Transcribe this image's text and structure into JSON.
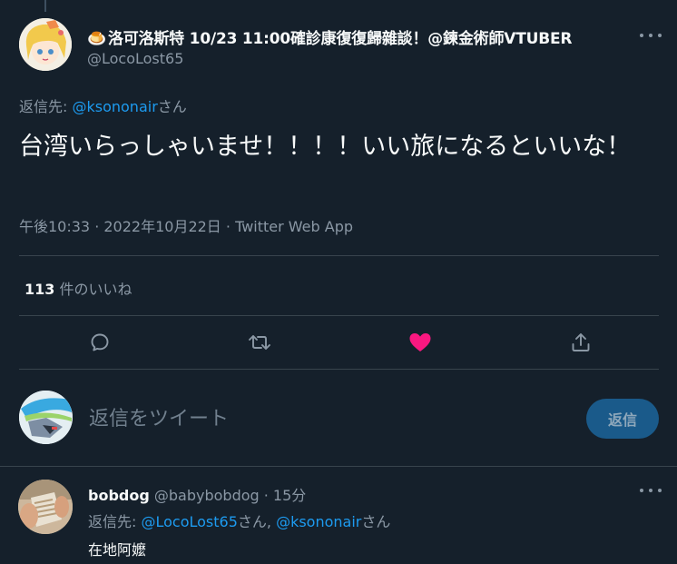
{
  "tweet": {
    "author": {
      "emoji": "🍮",
      "display_name": "洛可洛斯特 10/23 11:00確診康復復歸雜談！@鍊金術師VTUBER",
      "handle": "@LocoLost65",
      "avatar": "anime-avatar-icon"
    },
    "reply_to_label": "返信先: ",
    "reply_to_mention": "@ksononair",
    "reply_to_suffix": "さん",
    "text": "台湾いらっしゃいませ！！！！いい旅になるといいな！",
    "meta": "午後10:33 · 2022年10月22日 · Twitter Web App",
    "likes_count": "113",
    "likes_label": " 件のいいね",
    "actions": [
      "reply-icon",
      "retweet-icon",
      "liked-heart-icon",
      "share-icon"
    ]
  },
  "compose": {
    "placeholder": "返信をツイート",
    "button_label": "返信",
    "avatar": "mecha-avatar-icon"
  },
  "reply": {
    "name": "bobdog",
    "handle": " @babybobdog",
    "time": " · 15分",
    "reply_to_label": "返信先: ",
    "mention_1": "@LocoLost65",
    "between": "さん, ",
    "mention_2": "@ksononair",
    "suffix": "さん",
    "text": "在地阿嬤",
    "avatar": "photo-avatar-icon"
  },
  "colors": {
    "background": "#15202b",
    "accent": "#1d9bf0",
    "like": "#f91880",
    "muted": "#8b98a5"
  }
}
